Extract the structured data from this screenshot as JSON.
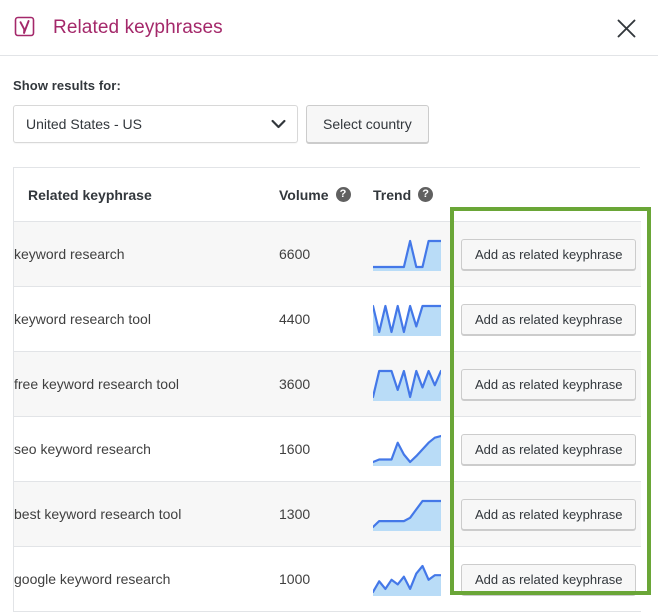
{
  "modal": {
    "title": "Related keyphrases",
    "logo_icon": "yoast-logo-icon",
    "close_icon": "close-icon",
    "brand_color": "#a4286a"
  },
  "country": {
    "label": "Show results for:",
    "selected": "United States - US",
    "chevron_icon": "chevron-down-icon",
    "button_label": "Select country"
  },
  "table": {
    "headers": {
      "keyphrase": "Related keyphrase",
      "volume": "Volume",
      "trend": "Trend",
      "help_glyph": "?"
    },
    "action_label": "Add as related keyphrase",
    "rows": [
      {
        "keyphrase": "keyword research",
        "volume": "6600",
        "trend_points": [
          52,
          52,
          52,
          52,
          52,
          52,
          30,
          52,
          52,
          30,
          30,
          30
        ],
        "action": "Add as related keyphrase"
      },
      {
        "keyphrase": "keyword research tool",
        "volume": "4400",
        "trend_points": [
          30,
          58,
          30,
          58,
          30,
          58,
          30,
          52,
          30,
          30,
          30,
          30
        ],
        "action": "Add as related keyphrase"
      },
      {
        "keyphrase": "free keyword research tool",
        "volume": "3600",
        "trend_points": [
          52,
          30,
          30,
          30,
          46,
          30,
          52,
          30,
          44,
          30,
          42,
          30
        ],
        "action": "Add as related keyphrase"
      },
      {
        "keyphrase": "seo keyword research",
        "volume": "1600",
        "trend_points": [
          55,
          52,
          52,
          52,
          32,
          46,
          55,
          48,
          40,
          32,
          26,
          24
        ],
        "action": "Add as related keyphrase"
      },
      {
        "keyphrase": "best keyword research tool",
        "volume": "1300",
        "trend_points": [
          55,
          48,
          48,
          48,
          48,
          48,
          44,
          34,
          24,
          24,
          24,
          24
        ],
        "action": "Add as related keyphrase"
      },
      {
        "keyphrase": "google keyword research",
        "volume": "1000",
        "trend_points": [
          50,
          36,
          46,
          34,
          40,
          30,
          46,
          26,
          16,
          34,
          28,
          28
        ],
        "action": "Add as related keyphrase"
      }
    ]
  },
  "annotation": {
    "name": "green-highlight-box",
    "color": "#6aa637"
  },
  "sparkline_colors": {
    "fill": "#b9dcf7",
    "stroke": "#4478e8"
  }
}
